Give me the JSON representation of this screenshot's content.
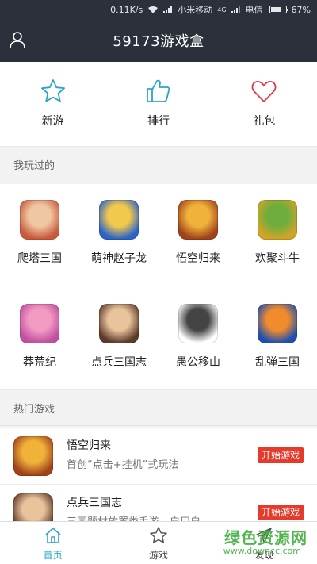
{
  "status_bar": {
    "speed": "0.11K/s",
    "carrier1": "小米移动",
    "network": "4G",
    "carrier2": "电信",
    "battery": "67%",
    "battery_level": 0.67,
    "icons": [
      "wifi-icon",
      "signal-icon",
      "battery-icon"
    ]
  },
  "header": {
    "title": "59173游戏盒",
    "user_icon": "user-icon"
  },
  "quick_nav": [
    {
      "label": "新游",
      "icon": "star-icon",
      "color": "#2aa4c7"
    },
    {
      "label": "排行",
      "icon": "thumbs-up-icon",
      "color": "#2aa4c7"
    },
    {
      "label": "礼包",
      "icon": "heart-icon",
      "color": "#e0384b"
    }
  ],
  "played_section": {
    "title": "我玩过的",
    "games": [
      {
        "name": "爬塔三国",
        "colors": [
          "#c75a3a",
          "#f0c6a3"
        ]
      },
      {
        "name": "萌神赵子龙",
        "colors": [
          "#2b63c7",
          "#f2c94c"
        ]
      },
      {
        "name": "悟空归来",
        "colors": [
          "#a0421b",
          "#f1b23a"
        ]
      },
      {
        "name": "欢聚斗牛",
        "colors": [
          "#d3a328",
          "#6fae3c"
        ]
      },
      {
        "name": "莽荒纪",
        "colors": [
          "#c04fa0",
          "#f39ac2"
        ]
      },
      {
        "name": "点兵三国志",
        "colors": [
          "#5c3a2a",
          "#e9c39b"
        ]
      },
      {
        "name": "愚公移山",
        "colors": [
          "#ffffff",
          "#444444"
        ]
      },
      {
        "name": "乱弹三国",
        "colors": [
          "#1f4fae",
          "#f08c2d"
        ]
      }
    ]
  },
  "hot_section": {
    "title": "热门游戏",
    "games": [
      {
        "name": "悟空归来",
        "desc": "首创“点击+挂机”式玩法",
        "button": "开始游戏",
        "colors": [
          "#a0421b",
          "#f1b23a"
        ]
      },
      {
        "name": "点兵三国志",
        "desc": "三国题材放置类手游，启用自",
        "button": "开始游戏",
        "colors": [
          "#5c3a2a",
          "#e9c39b"
        ]
      }
    ]
  },
  "bottom_nav": [
    {
      "label": "首页",
      "icon": "home-icon",
      "active": true
    },
    {
      "label": "游戏",
      "icon": "star-outline-icon",
      "active": false
    },
    {
      "label": "发现",
      "icon": "send-icon",
      "active": false
    }
  ],
  "watermark": {
    "text": "绿色资源网",
    "sub": "www.downcc.com"
  },
  "colors": {
    "header_bg": "#2b303b",
    "accent": "#2aa4c7",
    "start_button": "#e53b2c"
  }
}
